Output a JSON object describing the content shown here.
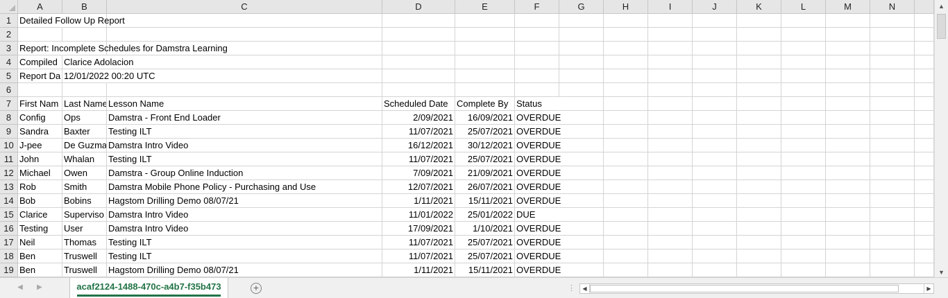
{
  "columns": [
    "A",
    "B",
    "C",
    "D",
    "E",
    "F",
    "G",
    "H",
    "I",
    "J",
    "K",
    "L",
    "M",
    "N"
  ],
  "rows": [
    {
      "n": "1",
      "cells": [
        "Detailed Follow Up Report",
        "",
        "",
        "",
        "",
        ""
      ]
    },
    {
      "n": "2",
      "cells": [
        "",
        "",
        "",
        "",
        "",
        ""
      ]
    },
    {
      "n": "3",
      "cells": [
        "Report: Incomplete Schedules for Damstra Learning",
        "",
        "",
        "",
        "",
        ""
      ]
    },
    {
      "n": "4",
      "cells": [
        "Compiled",
        "Clarice Adolacion",
        "",
        "",
        "",
        ""
      ]
    },
    {
      "n": "5",
      "cells": [
        "Report Da",
        "12/01/2022 00:20 UTC",
        "",
        "",
        "",
        ""
      ]
    },
    {
      "n": "6",
      "cells": [
        "",
        "",
        "",
        "",
        "",
        ""
      ]
    },
    {
      "n": "7",
      "cells": [
        "First Nam",
        "Last Name",
        "Lesson Name",
        "Scheduled Date",
        "Complete By",
        "Status"
      ]
    },
    {
      "n": "8",
      "cells": [
        "Config",
        "Ops",
        "Damstra - Front End Loader",
        "2/09/2021",
        "16/09/2021",
        "OVERDUE"
      ]
    },
    {
      "n": "9",
      "cells": [
        "Sandra",
        "Baxter",
        "Testing ILT",
        "11/07/2021",
        "25/07/2021",
        "OVERDUE"
      ]
    },
    {
      "n": "10",
      "cells": [
        "J-pee",
        "De Guzma",
        "Damstra Intro Video",
        "16/12/2021",
        "30/12/2021",
        "OVERDUE"
      ]
    },
    {
      "n": "11",
      "cells": [
        "John",
        "Whalan",
        "Testing ILT",
        "11/07/2021",
        "25/07/2021",
        "OVERDUE"
      ]
    },
    {
      "n": "12",
      "cells": [
        "Michael",
        "Owen",
        "Damstra -  Group Online Induction",
        "7/09/2021",
        "21/09/2021",
        "OVERDUE"
      ]
    },
    {
      "n": "13",
      "cells": [
        "Rob",
        "Smith",
        "Damstra Mobile Phone Policy - Purchasing and Use",
        "12/07/2021",
        "26/07/2021",
        "OVERDUE"
      ]
    },
    {
      "n": "14",
      "cells": [
        "Bob",
        "Bobins",
        "Hagstom Drilling Demo 08/07/21",
        "1/11/2021",
        "15/11/2021",
        "OVERDUE"
      ]
    },
    {
      "n": "15",
      "cells": [
        "Clarice",
        "Superviso",
        "Damstra Intro Video",
        "11/01/2022",
        "25/01/2022",
        "DUE"
      ]
    },
    {
      "n": "16",
      "cells": [
        "Testing",
        "User",
        "Damstra Intro Video",
        "17/09/2021",
        "1/10/2021",
        "OVERDUE"
      ]
    },
    {
      "n": "17",
      "cells": [
        "Neil",
        "Thomas",
        "Testing ILT",
        "11/07/2021",
        "25/07/2021",
        "OVERDUE"
      ]
    },
    {
      "n": "18",
      "cells": [
        "Ben",
        "Truswell",
        "Testing ILT",
        "11/07/2021",
        "25/07/2021",
        "OVERDUE"
      ]
    },
    {
      "n": "19",
      "cells": [
        "Ben",
        "Truswell",
        "Hagstom Drilling Demo 08/07/21",
        "1/11/2021",
        "15/11/2021",
        "OVERDUE"
      ]
    }
  ],
  "sheet_tab": "acaf2124-1488-470c-a4b7-f35b473",
  "add_sheet": "+",
  "colors": {
    "accent": "#217346",
    "header_bg": "#e6e6e6",
    "gridline": "#d4d4d4"
  }
}
